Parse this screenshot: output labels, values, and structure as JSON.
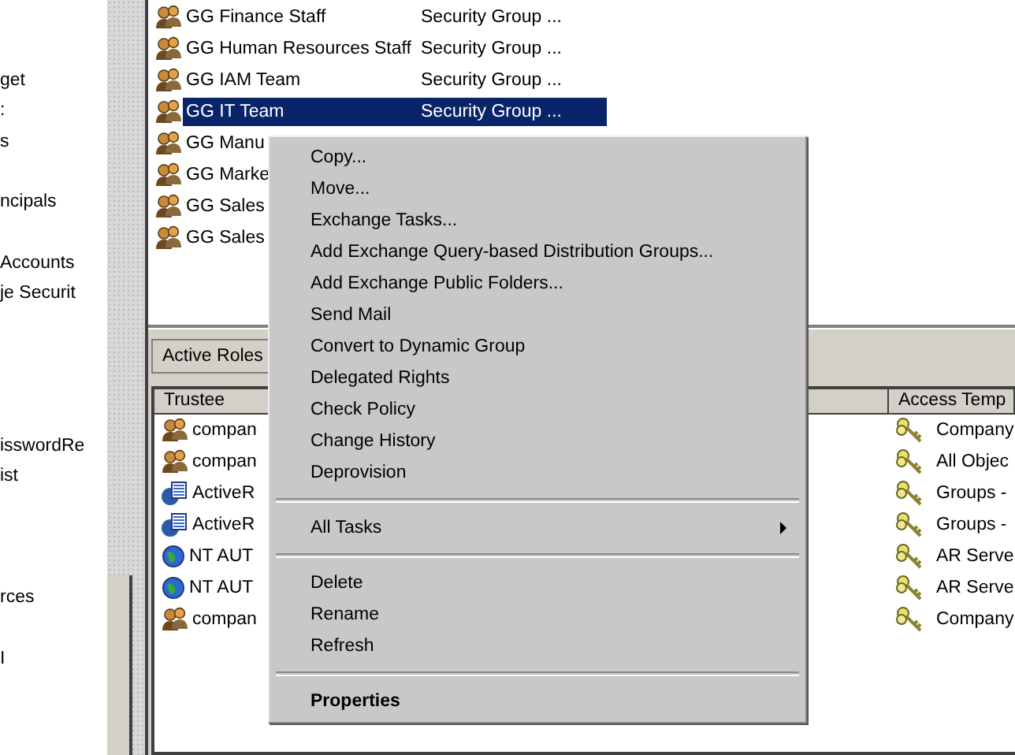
{
  "tree": {
    "items": [
      {
        "label": "get"
      },
      {
        "label": ":"
      },
      {
        "label": "s"
      },
      {
        "label": "ncipals"
      },
      {
        "label": "Accounts"
      },
      {
        "label": "je Securit"
      },
      {
        "label": "isswordRe"
      },
      {
        "label": "ist"
      },
      {
        "label": "rces"
      },
      {
        "label": "I"
      }
    ]
  },
  "groups": {
    "rows": [
      {
        "name": "GG Finance Staff",
        "type": "Security Group ...",
        "selected": false
      },
      {
        "name": "GG Human Resources Staff",
        "type": "Security Group ...",
        "selected": false
      },
      {
        "name": "GG IAM Team",
        "type": "Security Group ...",
        "selected": false
      },
      {
        "name": "GG IT Team",
        "type": "Security Group ...",
        "selected": true
      },
      {
        "name": "GG Manu",
        "selected": false
      },
      {
        "name": "GG Marke",
        "selected": false
      },
      {
        "name": "GG Sales",
        "selected": false
      },
      {
        "name": "GG Sales",
        "selected": false
      }
    ]
  },
  "roles_panel": {
    "title": "Active Roles",
    "columns": [
      "Trustee",
      "Access Temp"
    ],
    "rows": [
      {
        "trustee": "compan",
        "kind": "group",
        "template": "Company"
      },
      {
        "trustee": "compan",
        "kind": "group",
        "template": "All Objec"
      },
      {
        "trustee": "ActiveR",
        "kind": "service",
        "template": "Groups -"
      },
      {
        "trustee": "ActiveR",
        "kind": "service",
        "template": "Groups -"
      },
      {
        "trustee": "NT AUT",
        "kind": "globe",
        "template": "AR Serve"
      },
      {
        "trustee": "NT AUT",
        "kind": "globe",
        "template": "AR Serve"
      },
      {
        "trustee": "compan",
        "kind": "group",
        "template": "Company"
      }
    ]
  },
  "context_menu": {
    "items": [
      {
        "kind": "item",
        "label": "Copy..."
      },
      {
        "kind": "item",
        "label": "Move..."
      },
      {
        "kind": "item",
        "label": "Exchange Tasks..."
      },
      {
        "kind": "item",
        "label": "Add Exchange Query-based Distribution Groups..."
      },
      {
        "kind": "item",
        "label": "Add Exchange Public Folders..."
      },
      {
        "kind": "item",
        "label": "Send Mail"
      },
      {
        "kind": "item",
        "label": "Convert to Dynamic Group"
      },
      {
        "kind": "item",
        "label": "Delegated Rights"
      },
      {
        "kind": "item",
        "label": "Check Policy"
      },
      {
        "kind": "item",
        "label": "Change History"
      },
      {
        "kind": "item",
        "label": "Deprovision"
      },
      {
        "kind": "separator"
      },
      {
        "kind": "submenu",
        "label": "All Tasks"
      },
      {
        "kind": "separator"
      },
      {
        "kind": "item",
        "label": "Delete"
      },
      {
        "kind": "item",
        "label": "Rename"
      },
      {
        "kind": "item",
        "label": "Refresh"
      },
      {
        "kind": "separator"
      },
      {
        "kind": "default",
        "label": "Properties"
      }
    ]
  }
}
